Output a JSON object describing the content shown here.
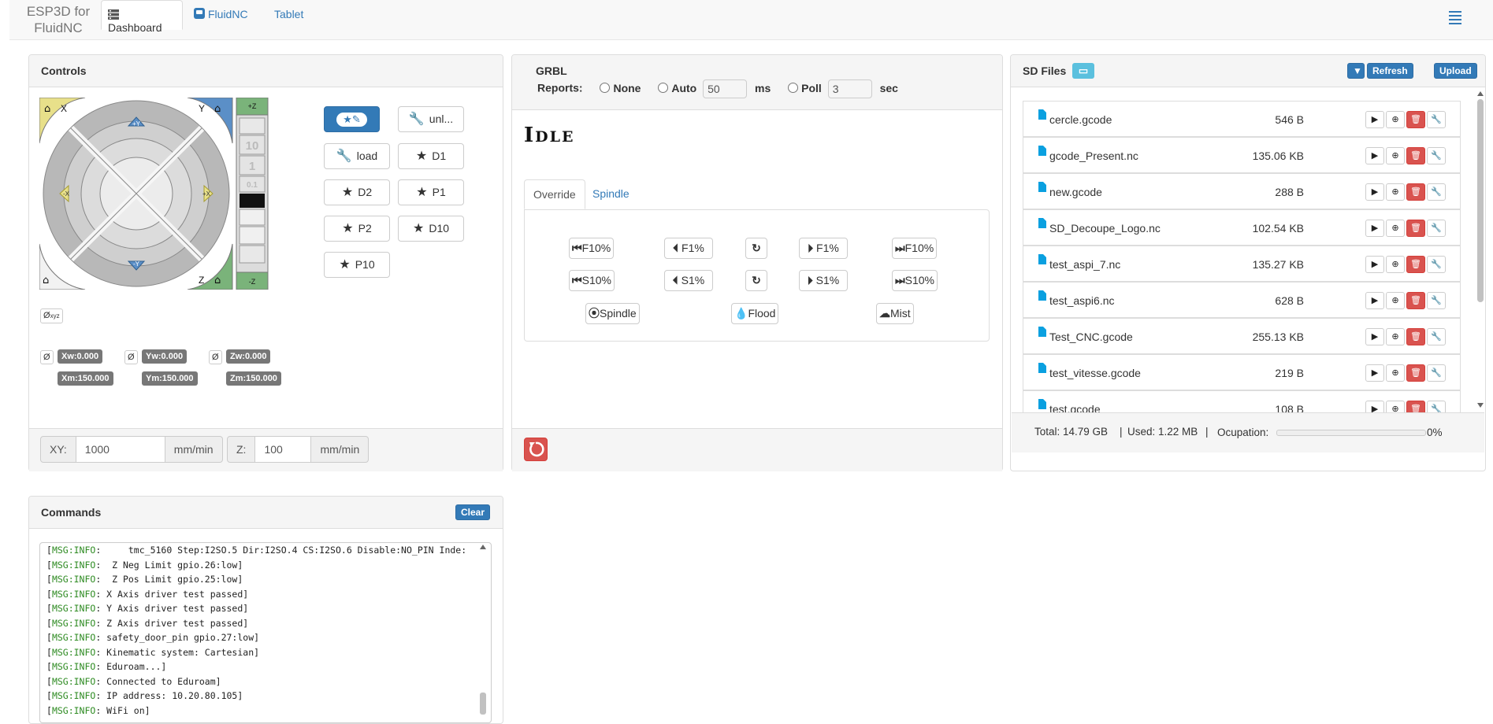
{
  "navbar": {
    "brand_line1": "ESP3D for",
    "brand_line2": "FluidNC",
    "tabs": [
      {
        "label": "Dashboard",
        "icon": "dashboard-icon",
        "active": true
      },
      {
        "label": "FluidNC",
        "icon": "fluidnc-icon",
        "active": false
      },
      {
        "label": "Tablet",
        "icon": "",
        "active": false
      }
    ],
    "menu_icon": "hamburger-menu-icon"
  },
  "controls": {
    "title": "Controls",
    "jog": {
      "corner_x": "X",
      "corner_y": "Y",
      "corner_z": "Z",
      "plus_y": "+Y",
      "minus_y": "-Y",
      "plus_x": "+X",
      "minus_x": "-X",
      "plus_z": "+Z",
      "minus_z": "-Z",
      "z_steps": [
        "10",
        "1",
        "0.1"
      ]
    },
    "macro_buttons": [
      {
        "label": "",
        "icon": "star-pencil-icon",
        "primary": true
      },
      {
        "label": "unl...",
        "icon": "wrench-icon"
      },
      {
        "label": "load",
        "icon": "wrench-icon"
      },
      {
        "label": "D1",
        "icon": "star-icon"
      },
      {
        "label": "D2",
        "icon": "star-icon"
      },
      {
        "label": "P1",
        "icon": "star-icon"
      },
      {
        "label": "P2",
        "icon": "star-icon"
      },
      {
        "label": "D10",
        "icon": "star-icon"
      },
      {
        "label": "P10",
        "icon": "star-icon"
      }
    ],
    "zero_all_label": "Ø",
    "zero_all_sub": "xyz",
    "zero_label": "Ø",
    "positions": {
      "xw": "Xw:0.000",
      "yw": "Yw:0.000",
      "zw": "Zw:0.000",
      "xm": "Xm:150.000",
      "ym": "Ym:150.000",
      "zm": "Zm:150.000"
    },
    "feed_xy": {
      "label": "XY:",
      "value": "1000",
      "unit": "mm/min"
    },
    "feed_z": {
      "label": "Z:",
      "value": "100",
      "unit": "mm/min"
    }
  },
  "grbl": {
    "title": "GRBL",
    "reports_label": "Reports:",
    "options": {
      "none": "None",
      "auto": "Auto",
      "poll": "Poll"
    },
    "auto_value": "50",
    "auto_unit": "ms",
    "poll_value": "3",
    "poll_unit": "sec",
    "state_first": "I",
    "state_rest": "DLE",
    "subtabs": [
      "Override",
      "Spindle"
    ],
    "overrides": {
      "f_minus10": "F10%",
      "f_minus1": "F1%",
      "f_plus1": "F1%",
      "f_plus10": "F10%",
      "s_minus10": "S10%",
      "s_minus1": "S1%",
      "s_plus1": "S1%",
      "s_plus10": "S10%",
      "spindle": "Spindle",
      "flood": "Flood",
      "mist": "Mist"
    }
  },
  "sd": {
    "title": "SD Files",
    "refresh_label": "Refresh",
    "upload_label": "Upload",
    "files": [
      {
        "name": "cercle.gcode",
        "size": "546 B"
      },
      {
        "name": "gcode_Present.nc",
        "size": "135.06 KB"
      },
      {
        "name": "new.gcode",
        "size": "288 B"
      },
      {
        "name": "SD_Decoupe_Logo.nc",
        "size": "102.54 KB"
      },
      {
        "name": "test_aspi_7.nc",
        "size": "135.27 KB"
      },
      {
        "name": "test_aspi6.nc",
        "size": "628 B"
      },
      {
        "name": "Test_CNC.gcode",
        "size": "255.13 KB"
      },
      {
        "name": "test_vitesse.gcode",
        "size": "219 B"
      },
      {
        "name": "test.gcode",
        "size": "108 B"
      }
    ],
    "footer": {
      "total": "Total: 14.79 GB",
      "sep": "|",
      "used": "Used: 1.22 MB",
      "occupation_label": "Ocupation:",
      "occupation_pct": "0%",
      "occupation_fraction": 0.0
    }
  },
  "commands": {
    "title": "Commands",
    "clear_label": "Clear",
    "lines": [
      {
        "pre": "[",
        "tag": "MSG:INFO",
        "text": ":     tmc_5160 Step:I2SO.5 Dir:I2SO.4 CS:I2SO.6 Disable:NO_PIN Inde:"
      },
      {
        "pre": "[",
        "tag": "MSG:INFO",
        "text": ":  Z Neg Limit gpio.26:low]"
      },
      {
        "pre": "[",
        "tag": "MSG:INFO",
        "text": ":  Z Pos Limit gpio.25:low]"
      },
      {
        "pre": "[",
        "tag": "MSG:INFO",
        "text": ": X Axis driver test passed]"
      },
      {
        "pre": "[",
        "tag": "MSG:INFO",
        "text": ": Y Axis driver test passed]"
      },
      {
        "pre": "[",
        "tag": "MSG:INFO",
        "text": ": Z Axis driver test passed]"
      },
      {
        "pre": "[",
        "tag": "MSG:INFO",
        "text": ": safety_door_pin gpio.27:low]"
      },
      {
        "pre": "[",
        "tag": "MSG:INFO",
        "text": ": Kinematic system: Cartesian]"
      },
      {
        "pre": "[",
        "tag": "MSG:INFO",
        "text": ": Eduroam...]"
      },
      {
        "pre": "[",
        "tag": "MSG:INFO",
        "text": ": Connected to Eduroam]"
      },
      {
        "pre": "[",
        "tag": "MSG:INFO",
        "text": ": IP address: 10.20.80.105]"
      },
      {
        "pre": "[",
        "tag": "MSG:INFO",
        "text": ": WiFi on]"
      }
    ]
  },
  "colors": {
    "primary": "#337ab7",
    "danger": "#d9534f",
    "console_tag": "#2e8b22",
    "jog_x": "#e8e08a",
    "jog_y": "#5b8fc7",
    "jog_z": "#7ab37a"
  }
}
